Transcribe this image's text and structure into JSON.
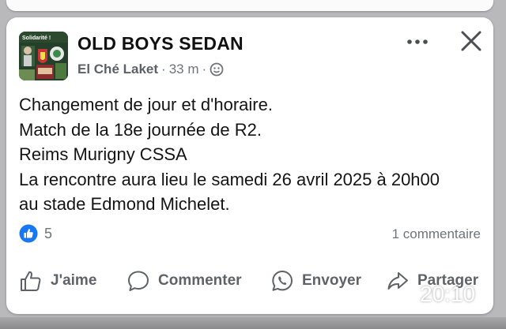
{
  "post": {
    "page_name": "OLD BOYS SEDAN",
    "author": "El Ché Laket",
    "time_ago": "33 m",
    "separator": "·",
    "avatar_caption": "Solidarité !",
    "text_lines": [
      "Changement de jour et d'horaire.",
      "Match de la 18e journée de R2.",
      "Reims Murigny CSSA",
      "La rencontre aura lieu le samedi 26 avril 2025 à 20h00",
      "au stade Edmond Michelet."
    ],
    "reaction_count": "5",
    "comments_count": "1 commentaire"
  },
  "actions": {
    "like": "J'aime",
    "comment": "Commenter",
    "send": "Envoyer",
    "share": "Partager"
  },
  "overlay": {
    "timestamp": "20:10"
  },
  "icons": {
    "reaction": "like-reaction-icon",
    "audience": "public-globe-icon",
    "more": "more-options-icon",
    "close": "close-icon"
  },
  "colors": {
    "like_blue": "#1877f2",
    "text_primary": "#141414",
    "text_secondary": "#6f7479"
  }
}
